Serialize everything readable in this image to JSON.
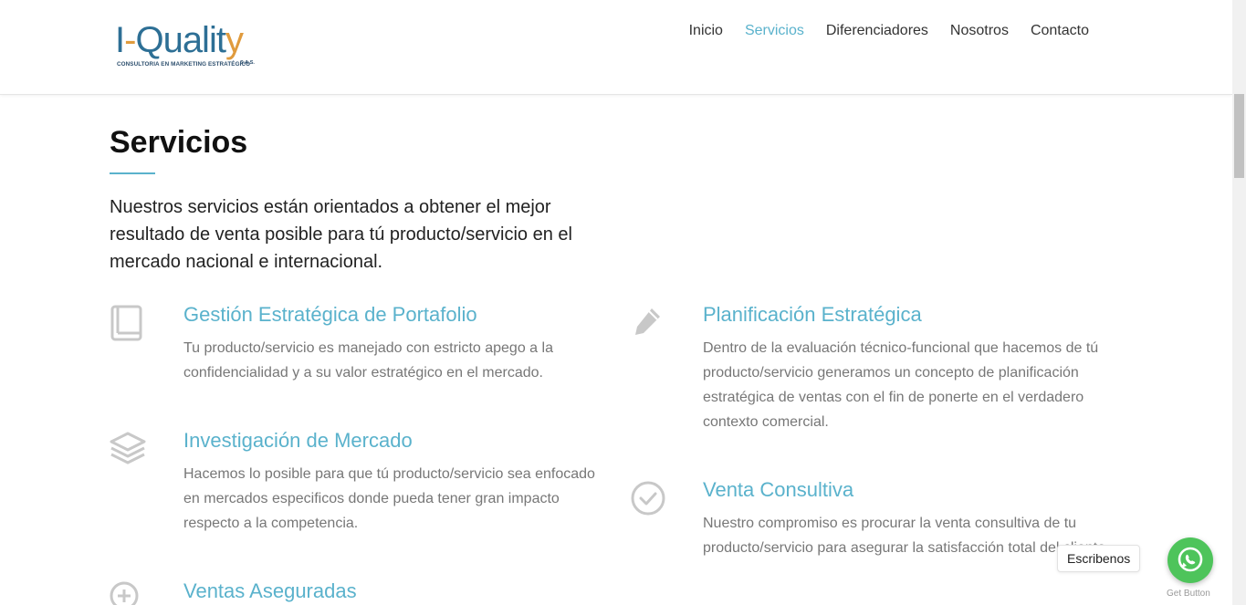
{
  "header": {
    "logo": {
      "brand_i": "I",
      "brand_dash": "-",
      "brand_qualit": "Qualit",
      "brand_y": "y",
      "tagline": "CONSULTORIA EN MARKETING ESTRATÉGICO",
      "suffix": "S.A.S."
    },
    "nav": [
      {
        "label": "Inicio",
        "active": false
      },
      {
        "label": "Servicios",
        "active": true
      },
      {
        "label": "Diferenciadores",
        "active": false
      },
      {
        "label": "Nosotros",
        "active": false
      },
      {
        "label": "Contacto",
        "active": false
      }
    ]
  },
  "section": {
    "title": "Servicios",
    "intro": "Nuestros servicios están orientados a obtener el mejor resultado de venta posible para tú producto/servicio en el mercado nacional e internacional."
  },
  "services": [
    {
      "icon": "book-icon",
      "title": "Gestión Estratégica de Portafolio",
      "description": "Tu producto/servicio es manejado con estricto apego a la confidencialidad y a su valor estratégico en el mercado."
    },
    {
      "icon": "pencil-icon",
      "title": "Planificación Estratégica",
      "description": "Dentro de la evaluación técnico-funcional que hacemos de tú producto/servicio generamos un concepto de planificación estratégica de ventas con el fin de ponerte en el verdadero contexto comercial."
    },
    {
      "icon": "layers-icon",
      "title": "Investigación de Mercado",
      "description": "Hacemos lo posible para que tú producto/servicio sea enfocado en mercados especificos donde pueda tener gran impacto respecto a la competencia."
    },
    {
      "icon": "check-circle-icon",
      "title": "Venta Consultiva",
      "description": "Nuestro compromiso es procurar la venta consultiva de tu producto/servicio para asegurar la satisfacción total del cliente."
    },
    {
      "icon": "plus-circle-icon",
      "title": "Ventas Aseguradas",
      "description": ""
    }
  ],
  "whatsapp": {
    "label": "Escribenos",
    "caption": "Get Button",
    "color": "#4ec45b"
  },
  "colors": {
    "accent": "#5ab2cc",
    "text_muted": "#777777",
    "icon_gray": "#c8c8c8"
  }
}
